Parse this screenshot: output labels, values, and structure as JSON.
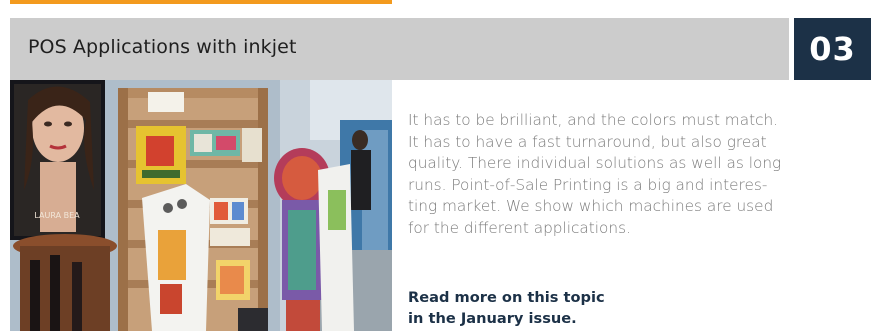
{
  "header": {
    "title": "POS Applications with inkjet",
    "issue_number": "03"
  },
  "colors": {
    "accent": "#f39a1e",
    "header_background": "#cccccc",
    "issue_box": "#1c3147",
    "body_text": "#7b7b7b"
  },
  "photo": {
    "poster_text": "LAURA BEA"
  },
  "article": {
    "body_lines": [
      "It has to be brilliant, and the colors must match.",
      "It has to have a fast turnaround, but also great",
      "quality. There individual solutions as well as long",
      "runs. Point-of-Sale Printing is a big and interes-",
      "ting market. We show which machines are used",
      "for the different applications."
    ],
    "read_more_lines": [
      "Read more on this topic",
      "in the January issue."
    ]
  }
}
